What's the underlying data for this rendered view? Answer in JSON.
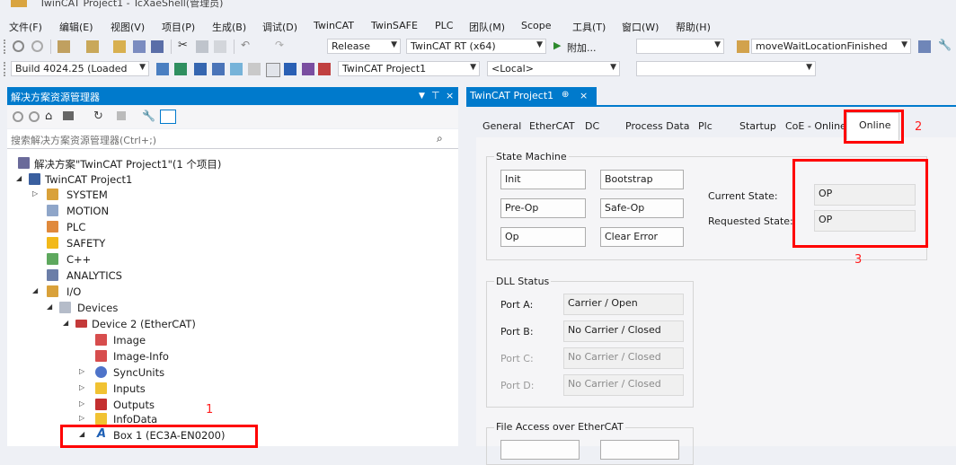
{
  "window": {
    "title": "TwinCAT Project1 - TcXaeShell(管理员)"
  },
  "menu": [
    "文件(F)",
    "编辑(E)",
    "视图(V)",
    "项目(P)",
    "生成(B)",
    "调试(D)",
    "TwinCAT",
    "TwinSAFE",
    "PLC",
    "团队(M)",
    "Scope",
    "工具(T)",
    "窗口(W)",
    "帮助(H)"
  ],
  "toolbar1": {
    "config": "Release",
    "platform": "TwinCAT RT (x64)",
    "attach": "附加...",
    "target_method": "moveWaitLocationFinished"
  },
  "toolbar2": {
    "build": "Build 4024.25 (Loaded",
    "project": "TwinCAT Project1",
    "target": "<Local>"
  },
  "solution_explorer": {
    "title": "解决方案资源管理器",
    "pin": "⊤",
    "close": "×",
    "search_placeholder": "搜索解决方案资源管理器(Ctrl+;)",
    "tree": [
      {
        "label": "解决方案\"TwinCAT Project1\"(1 个项目)",
        "icon": "solution-icon"
      },
      {
        "label": "TwinCAT Project1",
        "icon": "project-icon"
      },
      {
        "label": "SYSTEM",
        "icon": "system-icon"
      },
      {
        "label": "MOTION",
        "icon": "motion-icon"
      },
      {
        "label": "PLC",
        "icon": "plc-icon"
      },
      {
        "label": "SAFETY",
        "icon": "safety-icon"
      },
      {
        "label": "C++",
        "icon": "cpp-icon"
      },
      {
        "label": "ANALYTICS",
        "icon": "analytics-icon"
      },
      {
        "label": "I/O",
        "icon": "io-icon"
      },
      {
        "label": "Devices",
        "icon": "devices-icon"
      },
      {
        "label": "Device 2 (EtherCAT)",
        "icon": "ethercat-device-icon"
      },
      {
        "label": "Image",
        "icon": "image-icon"
      },
      {
        "label": "Image-Info",
        "icon": "image-info-icon"
      },
      {
        "label": "SyncUnits",
        "icon": "syncunits-icon"
      },
      {
        "label": "Inputs",
        "icon": "inputs-icon"
      },
      {
        "label": "Outputs",
        "icon": "outputs-icon"
      },
      {
        "label": "InfoData",
        "icon": "infodata-icon"
      },
      {
        "label": "Box 1 (EC3A-EN0200)",
        "icon": "box-icon"
      }
    ]
  },
  "editor": {
    "tab_title": "TwinCAT Project1",
    "tab_pin": "⊕",
    "tab_close": "×",
    "property_tabs": [
      "General",
      "EtherCAT",
      "DC",
      "Process Data",
      "Plc",
      "Startup",
      "CoE - Online",
      "Online"
    ],
    "state_machine": {
      "title": "State Machine",
      "buttons": [
        "Init",
        "Bootstrap",
        "Pre-Op",
        "Safe-Op",
        "Op",
        "Clear Error"
      ],
      "current_state_label": "Current State:",
      "current_state": "OP",
      "requested_state_label": "Requested State:",
      "requested_state": "OP"
    },
    "dll_status": {
      "title": "DLL Status",
      "ports": [
        {
          "label": "Port A:",
          "value": "Carrier / Open"
        },
        {
          "label": "Port B:",
          "value": "No Carrier / Closed"
        },
        {
          "label": "Port C:",
          "value": "No Carrier / Closed"
        },
        {
          "label": "Port D:",
          "value": "No Carrier / Closed"
        }
      ]
    },
    "file_access": {
      "title": "File Access over EtherCAT"
    }
  },
  "annotations": {
    "n1": "1",
    "n2": "2",
    "n3": "3"
  },
  "colors": {
    "accent": "#007acc",
    "annotation": "#ff0000"
  }
}
